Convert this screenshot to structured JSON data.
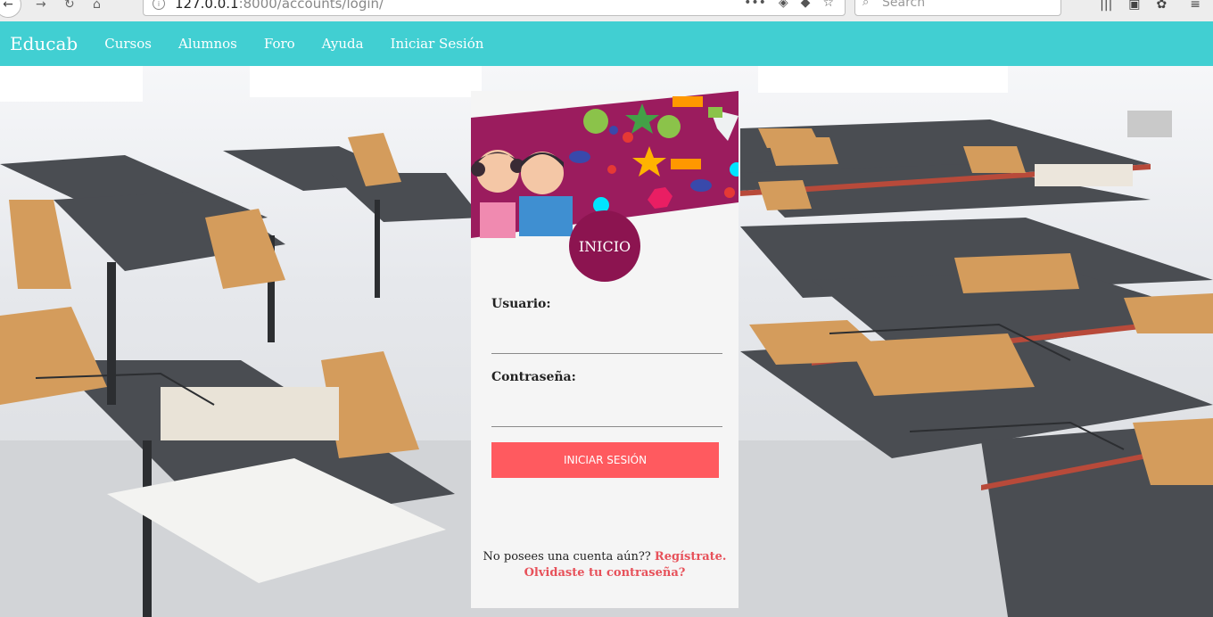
{
  "browser": {
    "url_host": "127.0.0.1",
    "url_rest": ":8000/accounts/login/",
    "search_placeholder": "Search"
  },
  "navbar": {
    "brand": "Educab",
    "links": [
      "Cursos",
      "Alumnos",
      "Foro",
      "Ayuda",
      "Iniciar Sesión"
    ]
  },
  "card": {
    "badge": "INICIO",
    "username_label": "Usuario:",
    "password_label": "Contraseña:",
    "submit_label": "INICIAR SESIÓN",
    "no_account_text": "No posees una cuenta aún??",
    "register_link": "Regístrate.",
    "forgot_link": "Olvidaste tu contraseña?"
  },
  "colors": {
    "navbar": "#41cfd2",
    "badge": "#8c1450",
    "button": "#ff5a5f",
    "link": "#e7515a"
  }
}
